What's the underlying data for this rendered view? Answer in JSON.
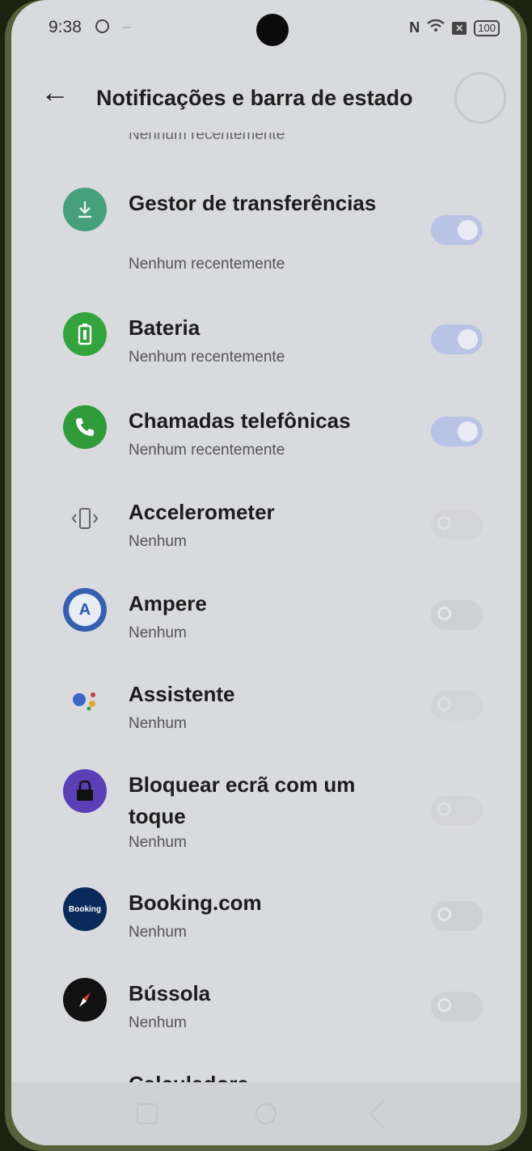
{
  "status_bar": {
    "time": "9:38",
    "nfc": "N",
    "battery": "100"
  },
  "header": {
    "title": "Notificações e barra de estado"
  },
  "top_cut_subtitle": "Nenhum recentemente",
  "apps": [
    {
      "name": "Gestor de transferências",
      "status": "Nenhum recentemente",
      "icon": "download-icon",
      "color": "#46a07c",
      "enabled": true
    },
    {
      "name": "Bateria",
      "status": "Nenhum recentemente",
      "icon": "battery-icon",
      "color": "#33a33d",
      "enabled": true
    },
    {
      "name": "Chamadas telefônicas",
      "status": "Nenhum recentemente",
      "icon": "phone-icon",
      "color": "#2f9b3a",
      "enabled": true
    },
    {
      "name": "Accelerometer",
      "status": "Nenhum",
      "icon": "accelerometer-icon",
      "color": "#d9dade",
      "enabled": false
    },
    {
      "name": "Ampere",
      "status": "Nenhum",
      "icon": "ampere-icon",
      "color": "#3560b0",
      "enabled": false
    },
    {
      "name": "Assistente",
      "status": "Nenhum",
      "icon": "assistant-icon",
      "color": "#d9dade",
      "enabled": false
    },
    {
      "name": "Bloquear ecrã com um toque",
      "status": "Nenhum",
      "icon": "lock-icon",
      "color": "#5a3fb6",
      "enabled": false
    },
    {
      "name": "Booking.com",
      "status": "Nenhum",
      "icon": "booking-icon",
      "color": "#0b2a5c",
      "icon_text": "Booking",
      "enabled": false
    },
    {
      "name": "Bússola",
      "status": "Nenhum",
      "icon": "compass-icon",
      "color": "#111111",
      "enabled": false
    },
    {
      "name": "Calculadora",
      "status": "",
      "icon": "calculator-icon",
      "color": "#d9dade",
      "enabled": false
    }
  ]
}
